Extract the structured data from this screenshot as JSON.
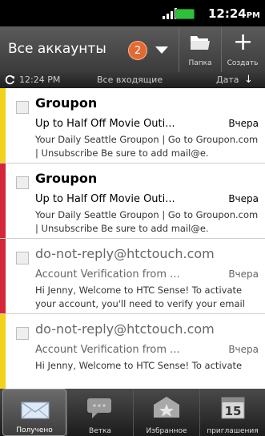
{
  "status_bar": {
    "time": "12:24",
    "time_suffix": "PM"
  },
  "header": {
    "account_title": "Все аккаунты",
    "unread_badge": "2",
    "folder_label": "Папка",
    "create_label": "Создать"
  },
  "subbar": {
    "sync_time": "12:24 PM",
    "folder_name": "Все входящие",
    "sort_label": "Дата"
  },
  "messages": [
    {
      "from": "Groupon",
      "subject": "Up to Half Off Movie Outi...",
      "date": "Вчера",
      "preview": "Your Daily Seattle Groupon | Go to Groupon.com | Unsubscribe Be sure to add mail@e.",
      "state": "unread",
      "accent_color": "#f2d21b"
    },
    {
      "from": "Groupon",
      "subject": "Up to Half Off Movie Outi...",
      "date": "Вчера",
      "preview": "Your Daily Seattle Groupon | Go to Groupon.com | Unsubscribe Be sure to add mail@e.",
      "state": "unread",
      "accent_color": "#d4263a"
    },
    {
      "from": "do-not-reply@htctouch.com",
      "subject": "Account Verification from ...",
      "date": "Вчера",
      "preview": "Hi Jenny, Welcome to HTC Sense! To activate your account, you'll need to verify your email",
      "state": "read",
      "accent_color": "#d4263a"
    },
    {
      "from": "do-not-reply@htctouch.com",
      "subject": "Account Verification from ...",
      "date": "Вчера",
      "preview": "Hi Jenny, Welcome to HTC Sense! To activate",
      "state": "read",
      "accent_color": "#f2d21b"
    }
  ],
  "tabs": [
    {
      "label": "Получено",
      "icon": "inbox-envelope-icon",
      "active": true
    },
    {
      "label": "Ветка",
      "icon": "conversation-icon",
      "active": false
    },
    {
      "label": "Избранное",
      "icon": "favorites-star-icon",
      "active": false
    },
    {
      "label": "приглашения",
      "icon": "calendar-invite-icon",
      "active": false
    }
  ],
  "calendar_icon_day": "15",
  "colors": {
    "badge": "#e26a32",
    "unread_strip": "#f2d21b",
    "flag_strip": "#d4263a"
  }
}
